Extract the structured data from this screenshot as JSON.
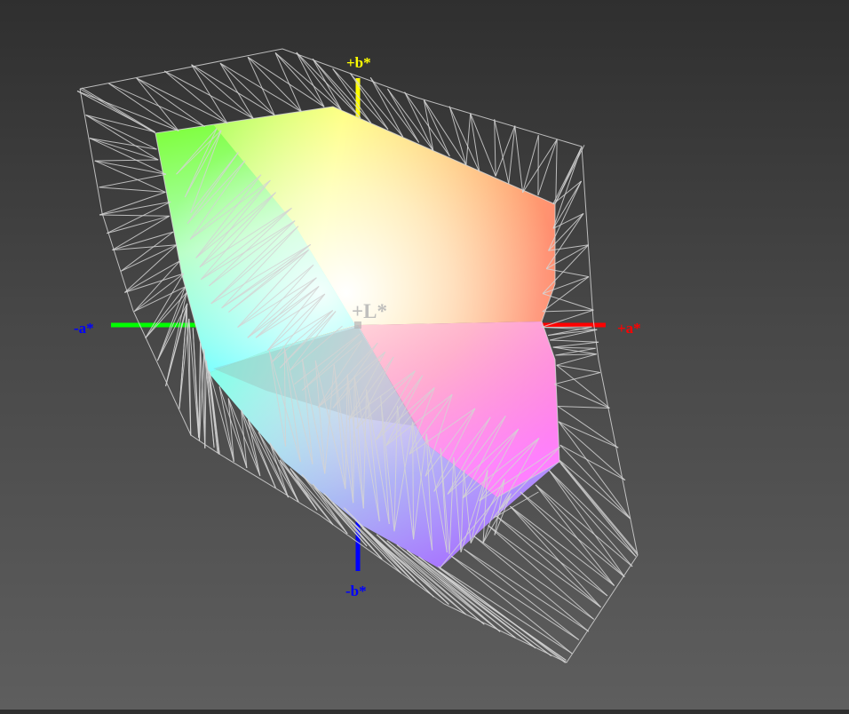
{
  "diagram": {
    "kind": "3d-color-gamut-volume",
    "colors": {
      "background_top": "#2f2f2f",
      "background_bottom": "#5e5e5e",
      "wireframe": "#d4d4d4",
      "axis_plus_b": "#ffff00",
      "axis_minus_b": "#0000ff",
      "axis_plus_a": "#ff0000",
      "axis_minus_a": "#00ff00",
      "label_plus_a": "#ff0000",
      "label_minus_a": "#0000ff",
      "label_L": "#b4b4b4"
    },
    "axes": {
      "plus_b": "+b*",
      "minus_b": "-b*",
      "plus_a": "+a*",
      "minus_a": "-a*",
      "lightness": "+L*"
    }
  }
}
